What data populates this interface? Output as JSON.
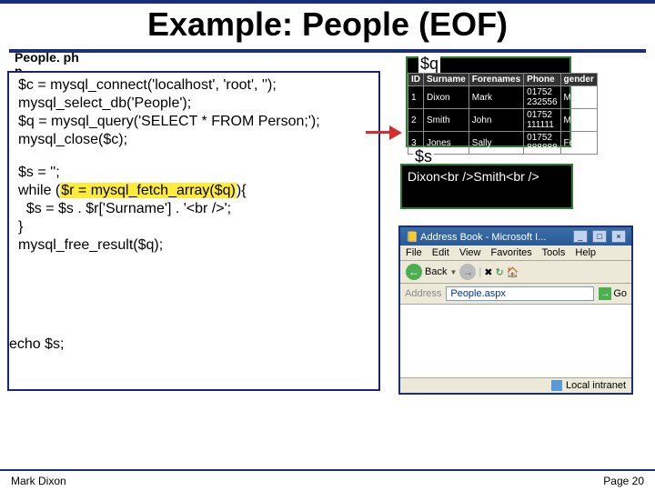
{
  "title": "Example: People (EOF)",
  "filename": "People. ph\np",
  "code": {
    "l1": "$c = mysql_connect('localhost', 'root', '');",
    "l2": "mysql_select_db('People');",
    "l3": "$q = mysql_query('SELECT * FROM Person;');",
    "l4": "mysql_close($c);",
    "l5": "$s = '';",
    "l6a": "while (",
    "l6b": "$r = mysql_fetch_array($q)",
    "l6c": "){",
    "l7": "  $s = $s . $r['Surname'] . '<br />';",
    "l8": "}",
    "l9": "mysql_free_result($q);",
    "l10": "echo $s;"
  },
  "q_label": "$q",
  "table": {
    "headers": [
      "ID",
      "Surname",
      "Forenames",
      "Phone",
      "gender"
    ],
    "rows": [
      [
        "1",
        "Dixon",
        "Mark",
        "01752 232556",
        "Male"
      ],
      [
        "2",
        "Smith",
        "John",
        "01752 111111",
        "Male"
      ],
      [
        "3",
        "Jones",
        "Sally",
        "01752 888888",
        "Female"
      ]
    ]
  },
  "s_label": "$s",
  "s_content": "Dixon<br />Smith<br />",
  "browser": {
    "title": "Address Book - Microsoft I...",
    "menu": [
      "File",
      "Edit",
      "View",
      "Favorites",
      "Tools",
      "Help"
    ],
    "back": "Back",
    "address_label": "Address",
    "url": "People.aspx",
    "go": "Go",
    "zone": "Local intranet"
  },
  "footer": {
    "left": "Mark Dixon",
    "right": "Page 20"
  }
}
